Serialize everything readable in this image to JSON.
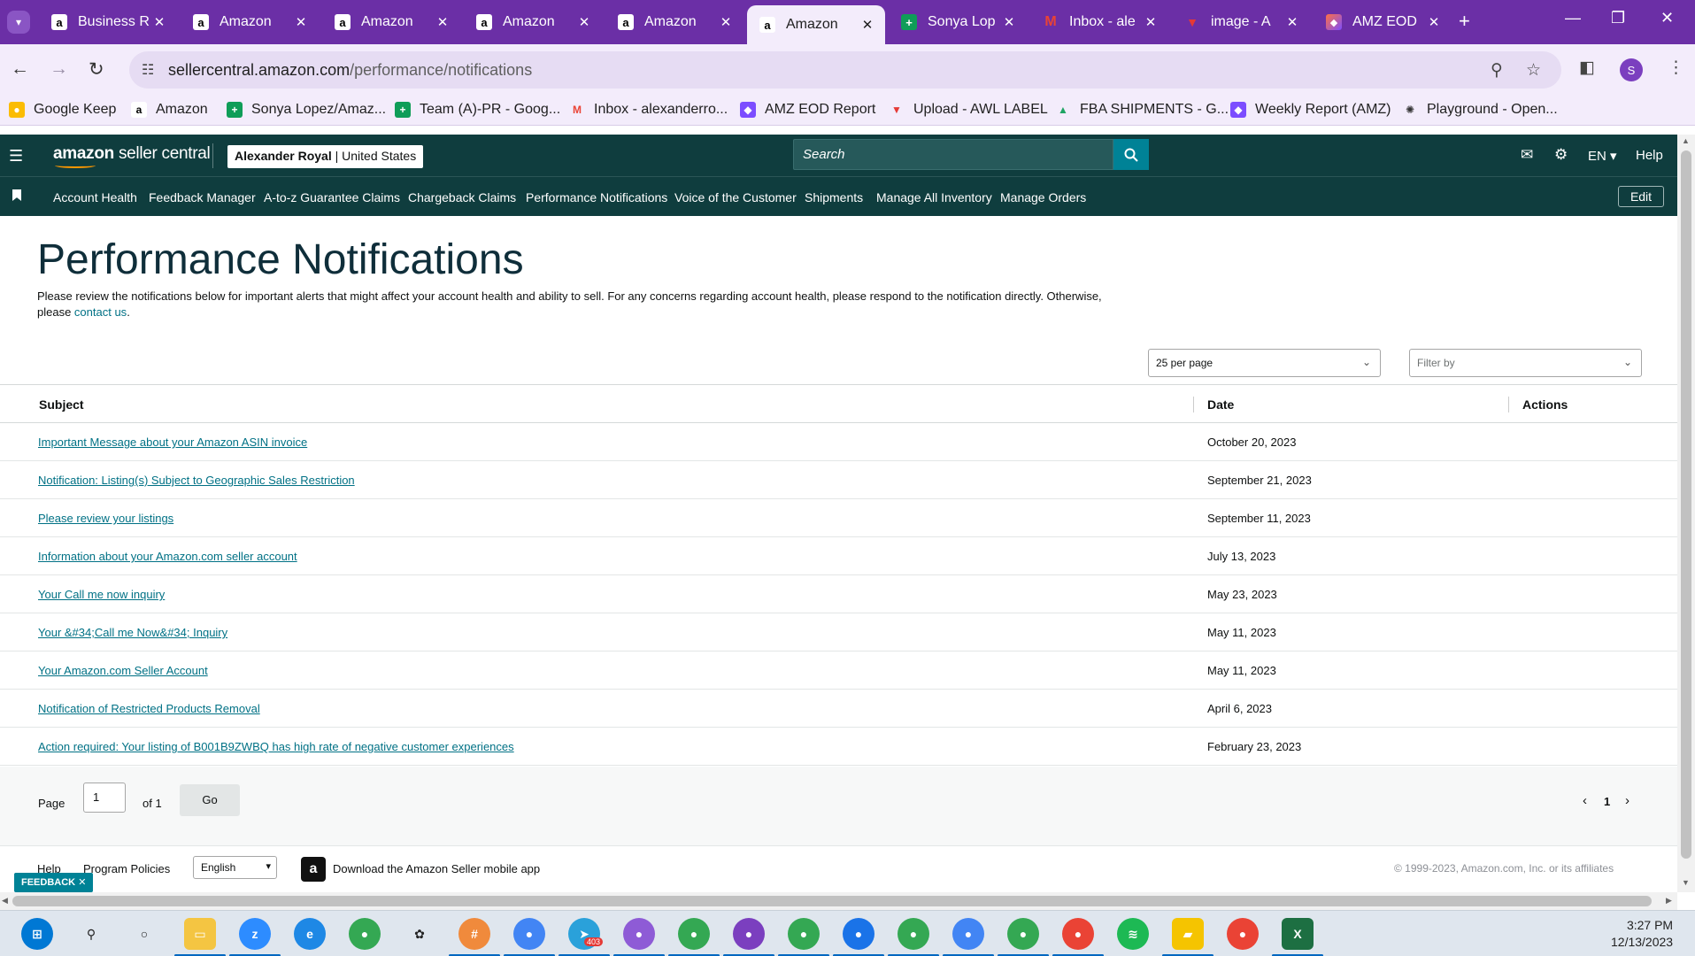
{
  "browser": {
    "tabs": [
      {
        "title": "Business R",
        "icon": "amazon"
      },
      {
        "title": "Amazon",
        "icon": "amazon"
      },
      {
        "title": "Amazon",
        "icon": "amazon"
      },
      {
        "title": "Amazon",
        "icon": "amazon"
      },
      {
        "title": "Amazon",
        "icon": "amazon"
      },
      {
        "title": "Amazon",
        "icon": "amazon",
        "active": true
      },
      {
        "title": "Sonya Lop",
        "icon": "sheets"
      },
      {
        "title": "Inbox - ale",
        "icon": "gmail"
      },
      {
        "title": "image - A",
        "icon": "awl"
      },
      {
        "title": "AMZ EOD",
        "icon": "eod"
      }
    ],
    "url_domain": "sellercentral.amazon.com",
    "url_path": "/performance/notifications",
    "profile_initial": "S",
    "bookmarks": [
      {
        "label": "Google Keep",
        "icon": "keep"
      },
      {
        "label": "Amazon",
        "icon": "amazon"
      },
      {
        "label": "Sonya Lopez/Amaz...",
        "icon": "sheets"
      },
      {
        "label": "Team (A)-PR - Goog...",
        "icon": "sheets"
      },
      {
        "label": "Inbox - alexanderro...",
        "icon": "gmail"
      },
      {
        "label": "AMZ EOD Report",
        "icon": "eod"
      },
      {
        "label": "Upload - AWL LABEL",
        "icon": "awl"
      },
      {
        "label": "FBA SHIPMENTS - G...",
        "icon": "drive"
      },
      {
        "label": "Weekly Report (AMZ)",
        "icon": "eod"
      },
      {
        "label": "Playground - Open...",
        "icon": "openai"
      }
    ]
  },
  "header": {
    "logo_brand": "amazon",
    "logo_product": "seller central",
    "account_name": "Alexander Royal",
    "account_region": "United States",
    "search_placeholder": "Search",
    "language": "EN",
    "help": "Help"
  },
  "nav": {
    "items": [
      "Account Health",
      "Feedback Manager",
      "A-to-z Guarantee Claims",
      "Chargeback Claims",
      "Performance Notifications",
      "Voice of the Customer",
      "Shipments",
      "Manage All Inventory",
      "Manage Orders"
    ],
    "edit_label": "Edit"
  },
  "page": {
    "title": "Performance Notifications",
    "intro_text": "Please review the notifications below for important alerts that might affect your account health and ability to sell. For any concerns regarding account health, please respond to the notification directly. Otherwise, please ",
    "intro_link": "contact us",
    "intro_end": ".",
    "per_page": "25 per page",
    "filter_placeholder": "Filter by"
  },
  "table": {
    "headers": {
      "subject": "Subject",
      "date": "Date",
      "actions": "Actions"
    },
    "rows": [
      {
        "subject": "Important Message about your Amazon ASIN invoice",
        "date": "October 20, 2023"
      },
      {
        "subject": "Notification: Listing(s) Subject to Geographic Sales Restriction",
        "date": "September 21, 2023"
      },
      {
        "subject": "Please review your listings",
        "date": "September 11, 2023"
      },
      {
        "subject": "Information about your Amazon.com seller account",
        "date": "July 13, 2023"
      },
      {
        "subject": "Your Call me now inquiry",
        "date": "May 23, 2023"
      },
      {
        "subject": "Your &#34;Call me Now&#34; Inquiry",
        "date": "May 11, 2023"
      },
      {
        "subject": "Your Amazon.com Seller Account",
        "date": "May 11, 2023"
      },
      {
        "subject": "Notification of Restricted Products Removal",
        "date": "April 6, 2023"
      },
      {
        "subject": "Action required: Your listing of B001B9ZWBQ has high rate of negative customer experiences",
        "date": "February 23, 2023"
      }
    ]
  },
  "pager": {
    "page_label": "Page",
    "page_value": "1",
    "of_label": "of 1",
    "go_label": "Go",
    "current_page": "1"
  },
  "footer": {
    "help": "Help",
    "program_policies": "Program Policies",
    "language": "English",
    "app_text": "Download the Amazon Seller mobile app",
    "copyright": "© 1999-2023, Amazon.com, Inc. or its affiliates",
    "feedback": "FEEDBACK"
  },
  "taskbar": {
    "time": "3:27 PM",
    "date": "12/13/2023",
    "telegram_badge": "403"
  }
}
